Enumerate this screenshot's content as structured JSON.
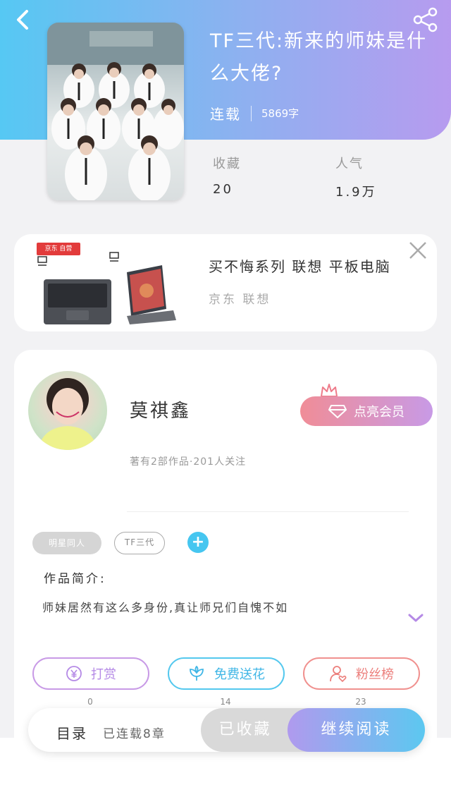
{
  "book": {
    "title": "TF三代:新来的师妹是什么大佬?",
    "status": "连载",
    "word_count": "5869字"
  },
  "stats": {
    "favorites_label": "收藏",
    "favorites_value": "20",
    "popularity_label": "人气",
    "popularity_value": "1.9万"
  },
  "ad": {
    "title": "买不悔系列 联想 平板电脑",
    "source": "京东 联想",
    "badge": "京东 自营"
  },
  "author": {
    "name": "莫祺鑫",
    "meta": "著有2部作品·201人关注",
    "vip_label": "点亮会员"
  },
  "tags": [
    "明星同人",
    "TF三代"
  ],
  "intro": {
    "label": "作品简介:",
    "text": "师妹居然有这么多身份,真让师兄们自愧不如"
  },
  "actions": [
    {
      "label": "打赏",
      "count": "0",
      "icon": "yen-coin-icon"
    },
    {
      "label": "免费送花",
      "count": "14",
      "icon": "flower-icon"
    },
    {
      "label": "粉丝榜",
      "count": "23",
      "icon": "fan-ranking-icon"
    }
  ],
  "bottom": {
    "toc_label": "目录",
    "toc_meta": "已连载8章",
    "collected_label": "已收藏",
    "read_label": "继续阅读"
  },
  "colors": {
    "header_gradient_start": "#56c8f3",
    "header_gradient_end": "#b79bef",
    "accent_blue": "#46c6f0",
    "accent_purple": "#c89ae6",
    "accent_pink": "#f0918f"
  }
}
